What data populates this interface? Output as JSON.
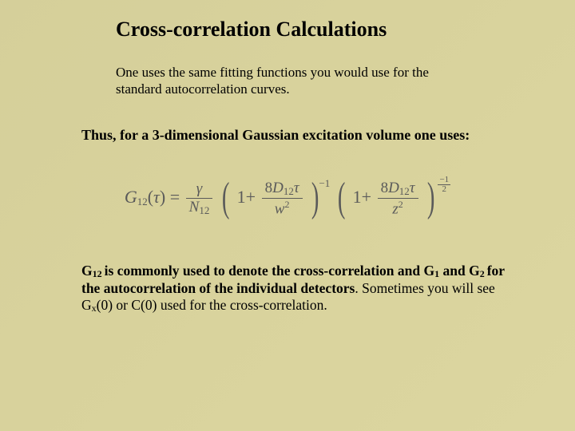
{
  "title": "Cross-correlation Calculations",
  "intro": "One uses the same fitting functions you would use for the standard autocorrelation curves.",
  "subhead": "Thus, for a 3-dimensional Gaussian excitation volume one uses:",
  "formula": {
    "lhs_G": "G",
    "lhs_sub": "12",
    "lhs_arg_open": "(",
    "lhs_tau": "τ",
    "lhs_arg_close": ") =",
    "gamma": "γ",
    "N": "N",
    "N_sub": "12",
    "one_plus": "1+",
    "coef": "8",
    "D": "D",
    "D_sub": "12",
    "tau": "τ",
    "w": "w",
    "w_exp": "2",
    "z": "z",
    "z_exp": "2",
    "exp1": "−1",
    "exp2_num": "−1",
    "exp2_den": "2"
  },
  "notes_parts": {
    "a": "G",
    "a_sub": "12 ",
    "b": "is commonly used to denote the cross-correlation and G",
    "b_sub": "1",
    "c": " and G",
    "c_sub": "2 ",
    "d": "for the autocorrelation of the individual detectors",
    "e": ". Sometimes you will see G",
    "e_sub": "x",
    "f": "(0) or C(0) used for the cross-correlation."
  }
}
